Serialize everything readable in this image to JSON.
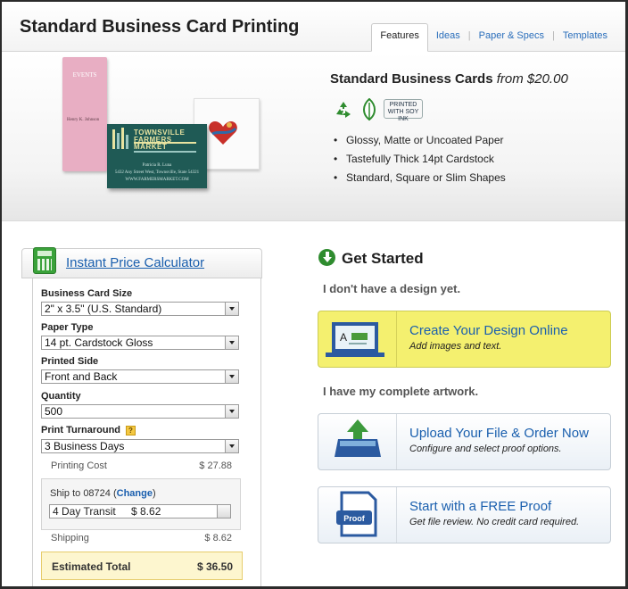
{
  "header": {
    "title": "Standard Business Card Printing",
    "tabs": [
      {
        "label": "Features",
        "active": true
      },
      {
        "label": "Ideas",
        "active": false
      },
      {
        "label": "Paper & Specs",
        "active": false
      },
      {
        "label": "Templates",
        "active": false
      }
    ]
  },
  "hero": {
    "product_name": "Standard Business Cards",
    "price_prefix": "from",
    "price": "$20.00",
    "eco_icons": [
      "recycle-icon",
      "leaf-icon",
      "soy-ink-icon"
    ],
    "soy_badge": "PRINTED WITH SOY INK",
    "features": [
      "Glossy, Matte or Uncoated Paper",
      "Tastefully Thick 14pt Cardstock",
      "Standard, Square or Slim Shapes"
    ],
    "sample_cards": {
      "pink_title": "EVENTS",
      "pink_name": "Henry K. Johnson",
      "green_title": "TOWNSVILLE FARMERS MARKET",
      "green_name": "Patricia R. Luna",
      "green_address": "5432 Any Street West, Townsville, State 54321",
      "green_web": "WWW.FARMERSMARKET.COM"
    }
  },
  "calculator": {
    "title": "Instant Price Calculator",
    "fields": {
      "size": {
        "label": "Business Card Size",
        "value": "2\" x 3.5\" (U.S. Standard)"
      },
      "paper": {
        "label": "Paper Type",
        "value": "14 pt. Cardstock Gloss"
      },
      "sides": {
        "label": "Printed Side",
        "value": "Front and Back"
      },
      "quantity": {
        "label": "Quantity",
        "value": "500"
      },
      "turnaround": {
        "label": "Print Turnaround",
        "value": "3 Business Days",
        "help": "?"
      }
    },
    "printing_cost_label": "Printing Cost",
    "printing_cost": "$ 27.88",
    "ship": {
      "prefix": "Ship to",
      "zip": "08724",
      "change_label": "Change",
      "method": "4 Day Transit",
      "method_price": "$ 8.62"
    },
    "shipping_label": "Shipping",
    "shipping_cost": "$ 8.62",
    "total_label": "Estimated Total",
    "total": "$ 36.50"
  },
  "get_started": {
    "title": "Get Started",
    "no_design_heading": "I don't have a design yet.",
    "complete_heading": "I have my complete artwork.",
    "options": [
      {
        "title": "Create Your Design Online",
        "subtitle": "Add images and text.",
        "icon": "design-online-icon"
      },
      {
        "title": "Upload Your File & Order Now",
        "subtitle": "Configure and select proof options.",
        "icon": "upload-tray-icon"
      },
      {
        "title": "Start with a FREE Proof",
        "subtitle": "Get file review. No credit card required.",
        "icon": "proof-document-icon",
        "icon_label": "Proof"
      }
    ]
  },
  "colors": {
    "link": "#1a5fae",
    "highlight": "#f4f06f",
    "total_bg": "#fdf6cf",
    "calc_green": "#3aa23a"
  }
}
